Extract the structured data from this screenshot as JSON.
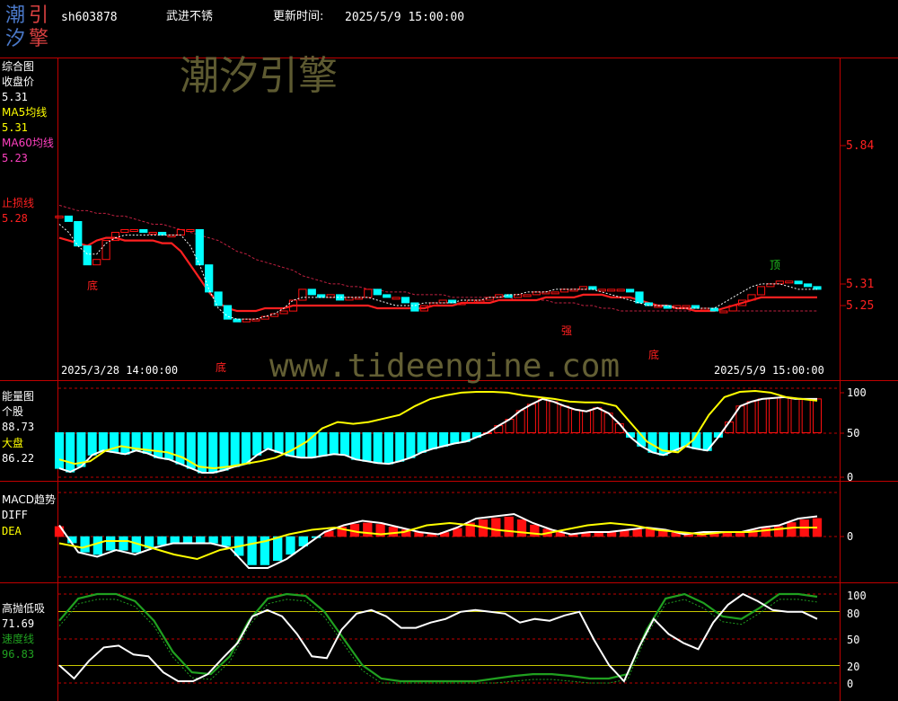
{
  "header": {
    "logo_chars": [
      "潮",
      "汐",
      "引",
      "擎"
    ],
    "stock_code": "sh603878",
    "stock_name": "武进不锈",
    "update_label": "更新时间:",
    "update_time": "2025/5/9 15:00:00"
  },
  "watermarks": {
    "brand": "潮汐引擎",
    "url": "www.tideengine.com"
  },
  "colors": {
    "background": "#000000",
    "frame_red": "#c00000",
    "label_white": "#ffffff",
    "ma5_yellow": "#ffff00",
    "ma60_magenta": "#ff40c0",
    "stop_red": "#ff2020",
    "up_red": "#ff1010",
    "down_cyan": "#00ffff",
    "speed_green": "#20a020",
    "watermark": "#6e6a3a"
  },
  "panel_main": {
    "title": "综合图",
    "close_label": "收盘价",
    "close_value": "5.31",
    "ma5_label": "MA5均线",
    "ma5_value": "5.31",
    "ma60_label": "MA60均线",
    "ma60_value": "5.23",
    "stop_label": "止损线",
    "stop_value": "5.28",
    "right_axis": [
      "5.84",
      "5.31",
      "5.25"
    ],
    "start_time": "2025/3/28 14:00:00",
    "end_time": "2025/5/9 15:00:00",
    "markers": [
      "底",
      "底",
      "强",
      "底",
      "顶"
    ]
  },
  "panel_energy": {
    "title": "能量图",
    "stock_label": "个股",
    "stock_value": "88.73",
    "market_label": "大盘",
    "market_value": "86.22",
    "axis": [
      "100",
      "50",
      "0"
    ]
  },
  "panel_macd": {
    "title": "MACD趋势",
    "diff_label": "DIFF",
    "dea_label": "DEA",
    "axis": [
      "0"
    ]
  },
  "panel_kdj": {
    "title": "高抛低吸",
    "value": "71.69",
    "speed_label": "速度线",
    "speed_value": "96.83",
    "axis": [
      "100",
      "80",
      "50",
      "20",
      "0"
    ]
  },
  "chart_data": [
    {
      "type": "candlestick",
      "x_range": [
        "2025/3/28 14:00:00",
        "2025/5/9 15:00:00"
      ],
      "close": [
        5.58,
        5.56,
        5.47,
        5.4,
        5.42,
        5.49,
        5.52,
        5.53,
        5.53,
        5.52,
        5.52,
        5.51,
        5.51,
        5.53,
        5.53,
        5.4,
        5.3,
        5.25,
        5.2,
        5.19,
        5.2,
        5.2,
        5.21,
        5.22,
        5.23,
        5.27,
        5.31,
        5.29,
        5.28,
        5.29,
        5.27,
        5.28,
        5.28,
        5.31,
        5.29,
        5.28,
        5.28,
        5.26,
        5.23,
        5.25,
        5.26,
        5.27,
        5.26,
        5.26,
        5.27,
        5.27,
        5.28,
        5.29,
        5.28,
        5.29,
        5.29,
        5.3,
        5.3,
        5.3,
        5.31,
        5.31,
        5.32,
        5.31,
        5.31,
        5.31,
        5.31,
        5.3,
        5.26,
        5.25,
        5.25,
        5.24,
        5.25,
        5.25,
        5.24,
        5.24,
        5.23,
        5.23,
        5.25,
        5.27,
        5.29,
        5.32,
        5.33,
        5.34,
        5.34,
        5.33,
        5.32,
        5.31
      ],
      "ma5": [
        5.55,
        5.52,
        5.47,
        5.44,
        5.44,
        5.48,
        5.5,
        5.51,
        5.51,
        5.51,
        5.51,
        5.51,
        5.51,
        5.51,
        5.47,
        5.4,
        5.31,
        5.24,
        5.21,
        5.2,
        5.2,
        5.2,
        5.21,
        5.22,
        5.24,
        5.27,
        5.28,
        5.28,
        5.28,
        5.28,
        5.28,
        5.28,
        5.28,
        5.28,
        5.27,
        5.26,
        5.25,
        5.25,
        5.25,
        5.26,
        5.26,
        5.26,
        5.26,
        5.27,
        5.27,
        5.27,
        5.28,
        5.28,
        5.29,
        5.29,
        5.3,
        5.3,
        5.3,
        5.31,
        5.31,
        5.31,
        5.31,
        5.31,
        5.3,
        5.29,
        5.28,
        5.27,
        5.26,
        5.25,
        5.25,
        5.25,
        5.24,
        5.24,
        5.24,
        5.24,
        5.24,
        5.26,
        5.28,
        5.3,
        5.32,
        5.33,
        5.33,
        5.33,
        5.32,
        5.31,
        5.31,
        5.31
      ],
      "ma60": [
        5.62,
        5.61,
        5.6,
        5.6,
        5.59,
        5.59,
        5.58,
        5.58,
        5.57,
        5.56,
        5.55,
        5.55,
        5.54,
        5.53,
        5.52,
        5.51,
        5.5,
        5.49,
        5.47,
        5.45,
        5.44,
        5.42,
        5.41,
        5.4,
        5.39,
        5.38,
        5.36,
        5.35,
        5.34,
        5.33,
        5.33,
        5.32,
        5.32,
        5.31,
        5.31,
        5.3,
        5.3,
        5.3,
        5.29,
        5.29,
        5.29,
        5.29,
        5.28,
        5.28,
        5.28,
        5.28,
        5.28,
        5.28,
        5.28,
        5.27,
        5.27,
        5.27,
        5.27,
        5.26,
        5.26,
        5.26,
        5.25,
        5.25,
        5.24,
        5.24,
        5.23,
        5.23,
        5.23,
        5.23,
        5.23,
        5.23,
        5.23,
        5.23,
        5.23,
        5.23,
        5.23,
        5.23,
        5.23,
        5.23,
        5.23,
        5.23,
        5.23,
        5.23,
        5.23,
        5.23,
        5.23,
        5.23
      ],
      "stop": [
        5.5,
        5.49,
        5.48,
        5.47,
        5.49,
        5.5,
        5.5,
        5.49,
        5.49,
        5.49,
        5.49,
        5.48,
        5.48,
        5.45,
        5.4,
        5.35,
        5.3,
        5.26,
        5.24,
        5.23,
        5.23,
        5.23,
        5.24,
        5.24,
        5.24,
        5.25,
        5.25,
        5.25,
        5.25,
        5.25,
        5.25,
        5.25,
        5.25,
        5.25,
        5.24,
        5.24,
        5.24,
        5.24,
        5.24,
        5.24,
        5.25,
        5.25,
        5.25,
        5.26,
        5.26,
        5.26,
        5.26,
        5.27,
        5.27,
        5.27,
        5.27,
        5.27,
        5.28,
        5.28,
        5.28,
        5.28,
        5.29,
        5.29,
        5.29,
        5.28,
        5.28,
        5.28,
        5.27,
        5.26,
        5.25,
        5.25,
        5.24,
        5.24,
        5.23,
        5.23,
        5.23,
        5.24,
        5.25,
        5.26,
        5.27,
        5.28,
        5.28,
        5.28,
        5.28,
        5.28,
        5.28,
        5.28
      ]
    },
    {
      "type": "line",
      "series": [
        {
          "name": "个股",
          "values": [
            10,
            6,
            12,
            25,
            30,
            28,
            26,
            30,
            27,
            22,
            20,
            15,
            10,
            5,
            5,
            8,
            12,
            15,
            25,
            32,
            28,
            24,
            22,
            22,
            24,
            26,
            25,
            20,
            18,
            16,
            15,
            18,
            22,
            28,
            32,
            35,
            38,
            40,
            45,
            50,
            58,
            65,
            75,
            82,
            88,
            85,
            80,
            76,
            74,
            78,
            72,
            60,
            45,
            35,
            28,
            25,
            30,
            35,
            32,
            30,
            45,
            62,
            80,
            85,
            88,
            89,
            90,
            88,
            88,
            88
          ]
        },
        {
          "name": "大盘",
          "values": [
            20,
            15,
            18,
            30,
            35,
            32,
            30,
            28,
            22,
            12,
            10,
            12,
            15,
            18,
            22,
            30,
            40,
            55,
            62,
            60,
            62,
            66,
            70,
            80,
            88,
            92,
            95,
            96,
            96,
            95,
            92,
            90,
            88,
            85,
            84,
            84,
            80,
            60,
            40,
            30,
            28,
            42,
            70,
            90,
            96,
            97,
            95,
            90,
            88,
            86
          ]
        }
      ],
      "ylim": [
        0,
        100
      ]
    },
    {
      "type": "bar",
      "series": [
        {
          "name": "DIFF",
          "values": [
            0.5,
            -0.7,
            -0.9,
            -0.6,
            -0.8,
            -0.5,
            -0.3,
            -0.3,
            -0.3,
            -0.5,
            -1.4,
            -1.4,
            -1.0,
            -0.4,
            0.2,
            0.5,
            0.7,
            0.6,
            0.4,
            0.2,
            0.1,
            0.4,
            0.8,
            0.9,
            1.0,
            0.6,
            0.3,
            0.1,
            0.2,
            0.2,
            0.3,
            0.4,
            0.3,
            0.1,
            0.2,
            0.2,
            0.2,
            0.4,
            0.5,
            0.8,
            0.9
          ]
        },
        {
          "name": "DEA",
          "values": [
            -0.3,
            -0.5,
            -0.2,
            -0.2,
            -0.5,
            -0.8,
            -1.0,
            -0.6,
            -0.4,
            -0.2,
            0.1,
            0.3,
            0.4,
            0.2,
            0.1,
            0.2,
            0.5,
            0.6,
            0.5,
            0.3,
            0.2,
            0.1,
            0.3,
            0.5,
            0.6,
            0.5,
            0.3,
            0.2,
            0.1,
            0.2,
            0.2,
            0.3,
            0.4,
            0.4
          ]
        }
      ],
      "zero_line": 0
    },
    {
      "type": "line",
      "series": [
        {
          "name": "高抛低吸",
          "values": [
            20,
            5,
            25,
            40,
            42,
            32,
            30,
            12,
            2,
            2,
            10,
            28,
            45,
            75,
            82,
            75,
            55,
            30,
            28,
            60,
            78,
            82,
            75,
            62,
            62,
            68,
            72,
            80,
            82,
            80,
            78,
            68,
            72,
            70,
            76,
            80,
            48,
            20,
            2,
            40,
            72,
            55,
            45,
            38,
            68,
            88,
            100,
            92,
            82,
            80,
            80,
            72
          ]
        },
        {
          "name": "速度线",
          "values": [
            70,
            95,
            100,
            100,
            92,
            70,
            35,
            12,
            10,
            30,
            70,
            95,
            100,
            98,
            80,
            50,
            20,
            5,
            2,
            2,
            2,
            2,
            2,
            5,
            8,
            10,
            10,
            8,
            5,
            5,
            10,
            60,
            95,
            100,
            90,
            75,
            72,
            85,
            100,
            100,
            97
          ]
        }
      ],
      "ylim": [
        0,
        100
      ],
      "reference_lines": [
        20,
        50,
        80
      ]
    }
  ]
}
